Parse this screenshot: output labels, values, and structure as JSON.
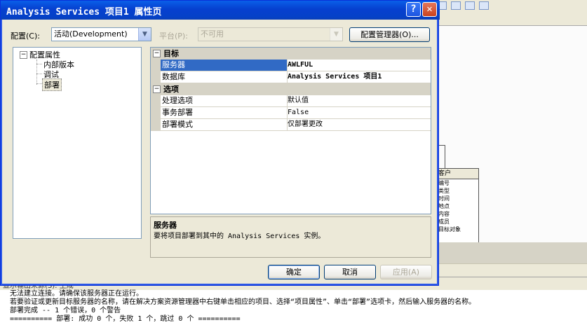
{
  "dialog": {
    "title": "Analysis Services 项目1 属性页",
    "help_glyph": "?",
    "close_glyph": "✕"
  },
  "config": {
    "config_label": "配置(C):",
    "config_value": "活动(Development)",
    "platform_label": "平台(P):",
    "platform_value": "不可用",
    "manager_button": "配置管理器(O)..."
  },
  "tree": {
    "root": "配置属性",
    "children": [
      "内部版本",
      "调试",
      "部署"
    ],
    "selected": "部署"
  },
  "grid": {
    "categories": [
      {
        "name": "目标",
        "rows": [
          {
            "name": "服务器",
            "value": "AWLFUL"
          },
          {
            "name": "数据库",
            "value": "Analysis Services 项目1"
          }
        ]
      },
      {
        "name": "选项",
        "rows": [
          {
            "name": "处理选项",
            "value": "默认值"
          },
          {
            "name": "事务部署",
            "value": "False"
          },
          {
            "name": "部署模式",
            "value": "仅部署更改"
          }
        ]
      }
    ]
  },
  "description": {
    "title": "服务器",
    "text": "要将项目部署到其中的 Analysis Services 实例。"
  },
  "buttons": {
    "ok": "确定",
    "cancel": "取消",
    "apply": "应用(A)"
  },
  "ide": {
    "table_header": "客户",
    "table_fields": [
      "编号",
      "类型",
      "时间",
      "地点",
      "内容",
      "成员",
      "目标对象"
    ],
    "output_title": "显示输出来源(S): 生成",
    "output_lines": [
      "无法建立连接。请确保该服务器正在运行。",
      "若要验证或更新目标服务器的名称，请在解决方案资源管理器中右键单击相应的项目、选择“项目属性”、单击“部署”选项卡，然后输入服务器的名称。",
      "部署完成 -- 1 个错误，0 个警告",
      "========== 部署: 成功 0 个，失败 1 个，跳过 0 个 =========="
    ]
  }
}
